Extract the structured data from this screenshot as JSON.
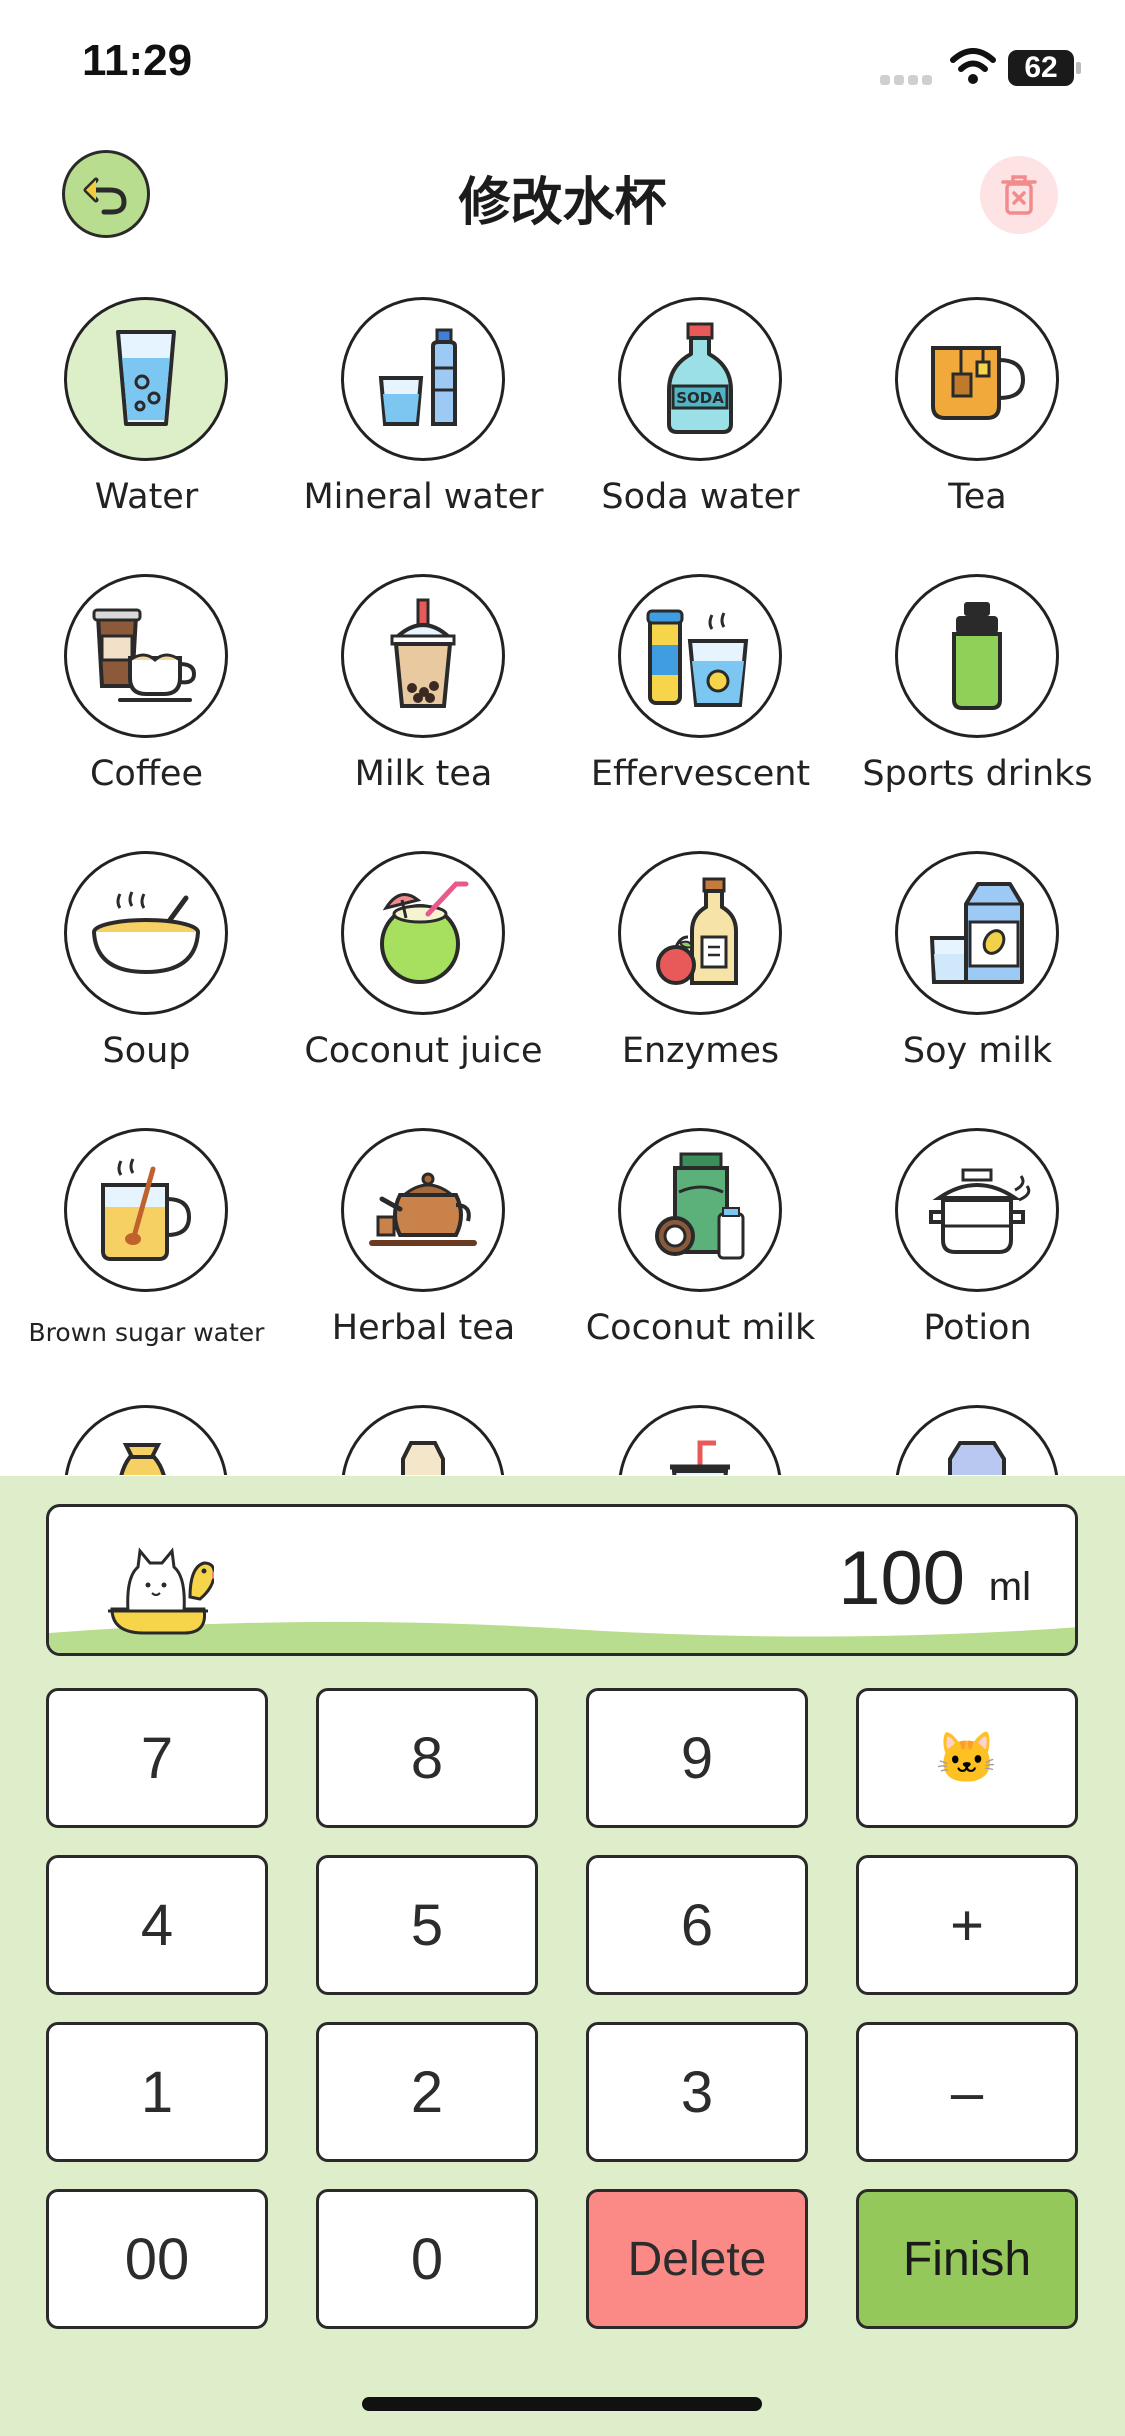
{
  "status": {
    "time": "11:29",
    "battery": "62"
  },
  "header": {
    "title": "修改水杯"
  },
  "drinks": [
    {
      "label": "Water",
      "icon": "water-glass-icon"
    },
    {
      "label": "Mineral water",
      "icon": "mineral-water-icon"
    },
    {
      "label": "Soda water",
      "icon": "soda-bottle-icon"
    },
    {
      "label": "Tea",
      "icon": "tea-mug-icon"
    },
    {
      "label": "Coffee",
      "icon": "coffee-icon"
    },
    {
      "label": "Milk tea",
      "icon": "bubble-milk-tea-icon"
    },
    {
      "label": "Effervescent",
      "icon": "effervescent-icon"
    },
    {
      "label": "Sports drinks",
      "icon": "sports-bottle-icon"
    },
    {
      "label": "Soup",
      "icon": "soup-bowl-icon"
    },
    {
      "label": "Coconut juice",
      "icon": "coconut-icon"
    },
    {
      "label": "Enzymes",
      "icon": "enzyme-bottle-icon"
    },
    {
      "label": "Soy milk",
      "icon": "soy-milk-icon"
    },
    {
      "label": "Brown sugar water",
      "icon": "brown-sugar-water-icon"
    },
    {
      "label": "Herbal tea",
      "icon": "teapot-icon"
    },
    {
      "label": "Coconut milk",
      "icon": "coconut-milk-icon"
    },
    {
      "label": "Potion",
      "icon": "pot-icon"
    }
  ],
  "partial_row_icons": [
    "jug-icon",
    "milk-carton-icon",
    "cup-straw-icon",
    "carton-icon"
  ],
  "selected_drink": "Water",
  "amount": {
    "value": "100",
    "unit": "ml"
  },
  "keypad": {
    "k7": "7",
    "k8": "8",
    "k9": "9",
    "k_cat": "🐱",
    "k4": "4",
    "k5": "5",
    "k6": "6",
    "k_plus": "+",
    "k1": "1",
    "k2": "2",
    "k3": "3",
    "k_minus": "–",
    "k00": "00",
    "k0": "0",
    "delete": "Delete",
    "finish": "Finish"
  },
  "colors": {
    "panel": "#deeecb",
    "accent_green": "#94c85b",
    "delete_red": "#fb8a86",
    "selected_bg": "#dcefc9"
  }
}
